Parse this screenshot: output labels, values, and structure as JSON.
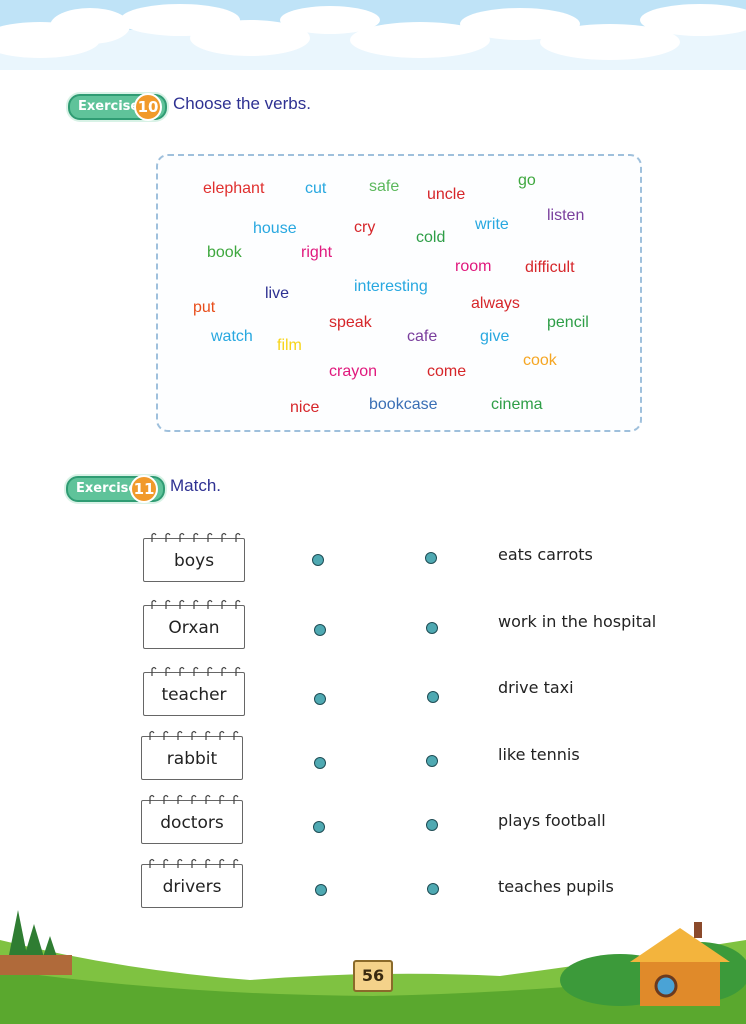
{
  "exercise10": {
    "label": "Exercise",
    "number": "10",
    "instruction": "Choose the verbs.",
    "words": [
      {
        "text": "elephant",
        "color": "#e0302f"
      },
      {
        "text": "cut",
        "color": "#28a8e0"
      },
      {
        "text": "safe",
        "color": "#5cb85c"
      },
      {
        "text": "uncle",
        "color": "#d6262a"
      },
      {
        "text": "go",
        "color": "#3fa83f"
      },
      {
        "text": "house",
        "color": "#28a8e0"
      },
      {
        "text": "cry",
        "color": "#d6262a"
      },
      {
        "text": "write",
        "color": "#28a8e0"
      },
      {
        "text": "listen",
        "color": "#7a3f9d"
      },
      {
        "text": "cold",
        "color": "#2e9e47"
      },
      {
        "text": "book",
        "color": "#3fa83f"
      },
      {
        "text": "right",
        "color": "#e0197d"
      },
      {
        "text": "room",
        "color": "#e0197d"
      },
      {
        "text": "difficult",
        "color": "#d6262a"
      },
      {
        "text": "live",
        "color": "#2e3192"
      },
      {
        "text": "interesting",
        "color": "#28a8e0"
      },
      {
        "text": "put",
        "color": "#e84e1b"
      },
      {
        "text": "always",
        "color": "#d6262a"
      },
      {
        "text": "speak",
        "color": "#d6262a"
      },
      {
        "text": "pencil",
        "color": "#2e9e47"
      },
      {
        "text": "watch",
        "color": "#28a8e0"
      },
      {
        "text": "film",
        "color": "#f7d417"
      },
      {
        "text": "cafe",
        "color": "#7a3f9d"
      },
      {
        "text": "give",
        "color": "#28a8e0"
      },
      {
        "text": "cook",
        "color": "#f5a623"
      },
      {
        "text": "crayon",
        "color": "#e0197d"
      },
      {
        "text": "come",
        "color": "#d6262a"
      },
      {
        "text": "nice",
        "color": "#d6262a"
      },
      {
        "text": "bookcase",
        "color": "#3a6fb5"
      },
      {
        "text": "cinema",
        "color": "#2e9e47"
      }
    ]
  },
  "exercise11": {
    "label": "Exercise",
    "number": "11",
    "instruction": "Match.",
    "subjects": [
      "boys",
      "Orxan",
      "teacher",
      "rabbit",
      "doctors",
      "drivers"
    ],
    "phrases": [
      "eats carrots",
      "work in the hospital",
      "drive taxi",
      "like tennis",
      "plays football",
      "teaches pupils"
    ]
  },
  "page_number": "56"
}
